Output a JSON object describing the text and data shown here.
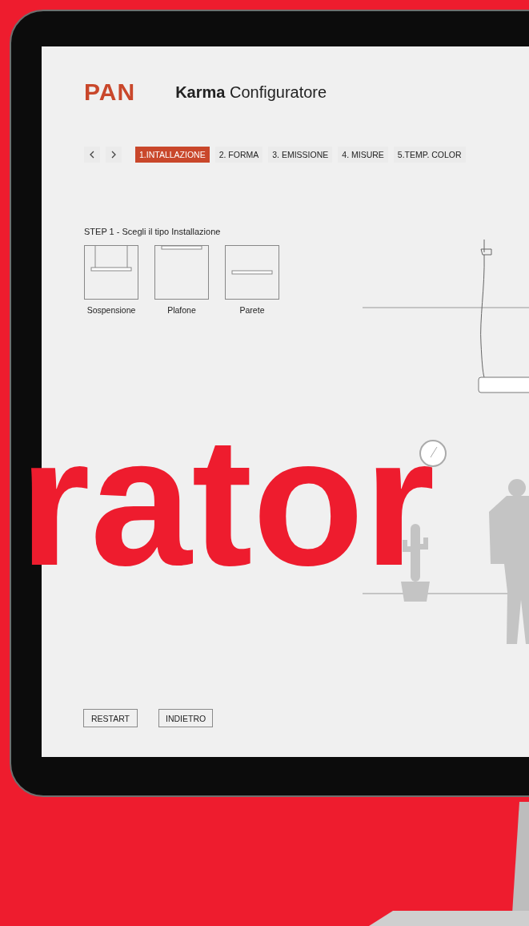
{
  "brand": {
    "logo": "PAN",
    "title": "**Karma** Configuratore"
  },
  "steps": [
    {
      "label": "1.INTALLAZIONE",
      "selected": true
    },
    {
      "label": "2. FORMA",
      "selected": false
    },
    {
      "label": "3. EMISSIONE",
      "selected": false
    },
    {
      "label": "4. MISURE",
      "selected": false
    },
    {
      "label": "5.TEMP. COLOR",
      "selected": false
    }
  ],
  "step_panel": {
    "heading": "STEP 1 - Scegli il tipo Installazione",
    "options": [
      {
        "label": "Sospensione",
        "kind": "suspension"
      },
      {
        "label": "Plafone",
        "kind": "ceiling"
      },
      {
        "label": "Parete",
        "kind": "wall"
      }
    ]
  },
  "buttons": [
    "RESTART",
    "INDIETRO"
  ],
  "headline": "rator"
}
